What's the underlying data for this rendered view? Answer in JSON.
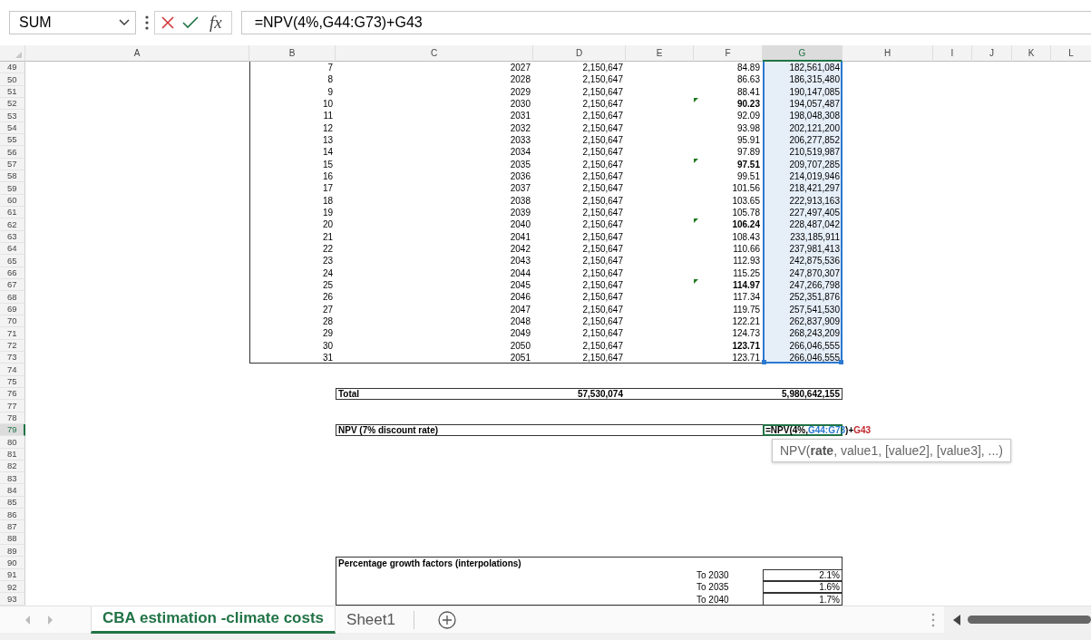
{
  "formula_bar": {
    "name_box": "SUM",
    "function_label": "fx",
    "formula": "=NPV(4%,G44:G73)+G43"
  },
  "columns": [
    {
      "label": "A",
      "selected": false
    },
    {
      "label": "B",
      "selected": false
    },
    {
      "label": "C",
      "selected": false
    },
    {
      "label": "D",
      "selected": false
    },
    {
      "label": "E",
      "selected": false
    },
    {
      "label": "F",
      "selected": false
    },
    {
      "label": "G",
      "selected": true
    },
    {
      "label": "H",
      "selected": false
    },
    {
      "label": "I",
      "selected": false
    },
    {
      "label": "J",
      "selected": false
    },
    {
      "label": "K",
      "selected": false
    },
    {
      "label": "L",
      "selected": false
    }
  ],
  "row_headers": [
    {
      "label": "49",
      "selected": false
    },
    {
      "label": "50",
      "selected": false
    },
    {
      "label": "51",
      "selected": false
    },
    {
      "label": "52",
      "selected": false
    },
    {
      "label": "53",
      "selected": false
    },
    {
      "label": "54",
      "selected": false
    },
    {
      "label": "55",
      "selected": false
    },
    {
      "label": "56",
      "selected": false
    },
    {
      "label": "57",
      "selected": false
    },
    {
      "label": "58",
      "selected": false
    },
    {
      "label": "59",
      "selected": false
    },
    {
      "label": "60",
      "selected": false
    },
    {
      "label": "61",
      "selected": false
    },
    {
      "label": "62",
      "selected": false
    },
    {
      "label": "63",
      "selected": false
    },
    {
      "label": "64",
      "selected": false
    },
    {
      "label": "65",
      "selected": false
    },
    {
      "label": "66",
      "selected": false
    },
    {
      "label": "67",
      "selected": false
    },
    {
      "label": "68",
      "selected": false
    },
    {
      "label": "69",
      "selected": false
    },
    {
      "label": "70",
      "selected": false
    },
    {
      "label": "71",
      "selected": false
    },
    {
      "label": "72",
      "selected": false
    },
    {
      "label": "73",
      "selected": false
    },
    {
      "label": "74",
      "selected": false
    },
    {
      "label": "75",
      "selected": false
    },
    {
      "label": "76",
      "selected": false
    },
    {
      "label": "77",
      "selected": false
    },
    {
      "label": "78",
      "selected": false
    },
    {
      "label": "79",
      "selected": true
    },
    {
      "label": "80",
      "selected": false
    },
    {
      "label": "81",
      "selected": false
    },
    {
      "label": "82",
      "selected": false
    },
    {
      "label": "83",
      "selected": false
    },
    {
      "label": "84",
      "selected": false
    },
    {
      "label": "85",
      "selected": false
    },
    {
      "label": "86",
      "selected": false
    },
    {
      "label": "87",
      "selected": false
    },
    {
      "label": "88",
      "selected": false
    },
    {
      "label": "89",
      "selected": false
    },
    {
      "label": "90",
      "selected": false
    },
    {
      "label": "91",
      "selected": false
    },
    {
      "label": "92",
      "selected": false
    },
    {
      "label": "93",
      "selected": false
    }
  ],
  "schedule": {
    "reference_highlight": true,
    "rows": [
      {
        "B": "7",
        "C": "2027",
        "D": "2,150,647",
        "F": "84.89",
        "G": "182,561,084",
        "F_bold": false,
        "F_flag": false
      },
      {
        "B": "8",
        "C": "2028",
        "D": "2,150,647",
        "F": "86.63",
        "G": "186,315,480",
        "F_bold": false,
        "F_flag": false
      },
      {
        "B": "9",
        "C": "2029",
        "D": "2,150,647",
        "F": "88.41",
        "G": "190,147,085",
        "F_bold": false,
        "F_flag": false
      },
      {
        "B": "10",
        "C": "2030",
        "D": "2,150,647",
        "F": "90.23",
        "G": "194,057,487",
        "F_bold": true,
        "F_flag": true
      },
      {
        "B": "11",
        "C": "2031",
        "D": "2,150,647",
        "F": "92.09",
        "G": "198,048,308",
        "F_bold": false,
        "F_flag": false
      },
      {
        "B": "12",
        "C": "2032",
        "D": "2,150,647",
        "F": "93.98",
        "G": "202,121,200",
        "F_bold": false,
        "F_flag": false
      },
      {
        "B": "13",
        "C": "2033",
        "D": "2,150,647",
        "F": "95.91",
        "G": "206,277,852",
        "F_bold": false,
        "F_flag": false
      },
      {
        "B": "14",
        "C": "2034",
        "D": "2,150,647",
        "F": "97.89",
        "G": "210,519,987",
        "F_bold": false,
        "F_flag": false
      },
      {
        "B": "15",
        "C": "2035",
        "D": "2,150,647",
        "F": "97.51",
        "G": "209,707,285",
        "F_bold": true,
        "F_flag": true
      },
      {
        "B": "16",
        "C": "2036",
        "D": "2,150,647",
        "F": "99.51",
        "G": "214,019,946",
        "F_bold": false,
        "F_flag": false
      },
      {
        "B": "17",
        "C": "2037",
        "D": "2,150,647",
        "F": "101.56",
        "G": "218,421,297",
        "F_bold": false,
        "F_flag": false
      },
      {
        "B": "18",
        "C": "2038",
        "D": "2,150,647",
        "F": "103.65",
        "G": "222,913,163",
        "F_bold": false,
        "F_flag": false
      },
      {
        "B": "19",
        "C": "2039",
        "D": "2,150,647",
        "F": "105.78",
        "G": "227,497,405",
        "F_bold": false,
        "F_flag": false
      },
      {
        "B": "20",
        "C": "2040",
        "D": "2,150,647",
        "F": "106.24",
        "G": "228,487,042",
        "F_bold": true,
        "F_flag": true
      },
      {
        "B": "21",
        "C": "2041",
        "D": "2,150,647",
        "F": "108.43",
        "G": "233,185,911",
        "F_bold": false,
        "F_flag": false
      },
      {
        "B": "22",
        "C": "2042",
        "D": "2,150,647",
        "F": "110.66",
        "G": "237,981,413",
        "F_bold": false,
        "F_flag": false
      },
      {
        "B": "23",
        "C": "2043",
        "D": "2,150,647",
        "F": "112.93",
        "G": "242,875,536",
        "F_bold": false,
        "F_flag": false
      },
      {
        "B": "24",
        "C": "2044",
        "D": "2,150,647",
        "F": "115.25",
        "G": "247,870,307",
        "F_bold": false,
        "F_flag": false
      },
      {
        "B": "25",
        "C": "2045",
        "D": "2,150,647",
        "F": "114.97",
        "G": "247,266,798",
        "F_bold": true,
        "F_flag": true
      },
      {
        "B": "26",
        "C": "2046",
        "D": "2,150,647",
        "F": "117.34",
        "G": "252,351,876",
        "F_bold": false,
        "F_flag": false
      },
      {
        "B": "27",
        "C": "2047",
        "D": "2,150,647",
        "F": "119.75",
        "G": "257,541,530",
        "F_bold": false,
        "F_flag": false
      },
      {
        "B": "28",
        "C": "2048",
        "D": "2,150,647",
        "F": "122.21",
        "G": "262,837,909",
        "F_bold": false,
        "F_flag": false
      },
      {
        "B": "29",
        "C": "2049",
        "D": "2,150,647",
        "F": "124.73",
        "G": "268,243,209",
        "F_bold": false,
        "F_flag": false
      },
      {
        "B": "30",
        "C": "2050",
        "D": "2,150,647",
        "F": "123.71",
        "G": "266,046,555",
        "F_bold": true,
        "F_flag": false
      },
      {
        "B": "31",
        "C": "2051",
        "D": "2,150,647",
        "F": "123.71",
        "G": "266,046,555",
        "F_bold": false,
        "F_flag": false
      }
    ]
  },
  "total_row": {
    "label": "Total",
    "D": "57,530,074",
    "G": "5,980,642,155"
  },
  "npv_row": {
    "label": "NPV (7% discount rate)",
    "formula": [
      {
        "text": "=NPV(4%,",
        "kind": "plain"
      },
      {
        "text": "G44:G73",
        "kind": "range"
      },
      {
        "text": ")+",
        "kind": "plain"
      },
      {
        "text": "G43",
        "kind": "cell"
      }
    ]
  },
  "tooltip": "NPV(**rate**, value1, [value2], [value3], ...)",
  "growth_table": {
    "title": "Percentage growth factors (interpolations)",
    "rows": [
      {
        "label": "To 2030",
        "value": "2.1%"
      },
      {
        "label": "To 2035",
        "value": "1.6%"
      },
      {
        "label": "To 2040",
        "value": "1.7%"
      }
    ]
  },
  "sheet_tabs": [
    {
      "label": "CBA estimation -climate costs",
      "selected": true
    },
    {
      "label": "Sheet1",
      "selected": false
    }
  ]
}
